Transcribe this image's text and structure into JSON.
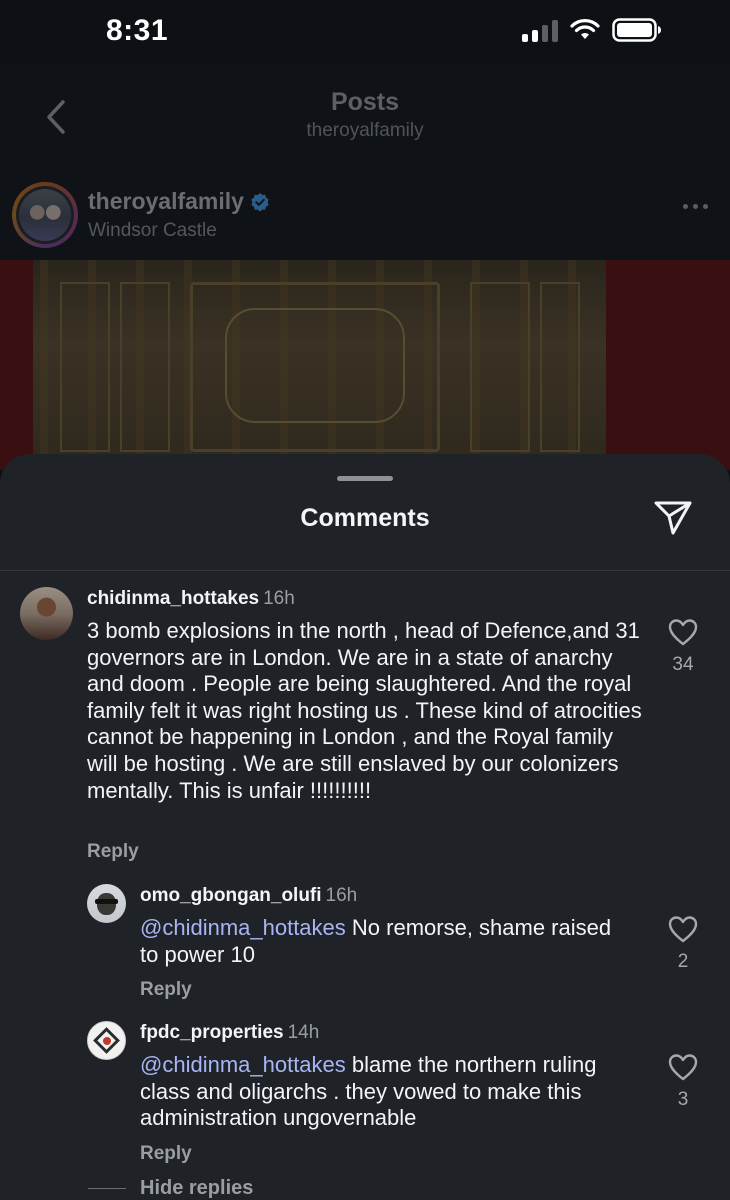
{
  "status_bar": {
    "time": "8:31"
  },
  "header": {
    "title": "Posts",
    "subtitle": "theroyalfamily"
  },
  "post": {
    "username": "theroyalfamily",
    "location": "Windsor Castle"
  },
  "comments_sheet": {
    "title": "Comments",
    "comments": [
      {
        "username": "chidinma_hottakes",
        "time": "16h",
        "text": "3 bomb explosions in the north , head of Defence,and 31 governors are in London. We are in a state of anarchy and doom . People are being slaughtered. And the royal family felt it was right hosting us . These kind of atrocities cannot be happening in London , and the Royal family will be hosting . We are still enslaved by our colonizers mentally. This is unfair !!!!!!!!!!",
        "reply_label": "Reply",
        "likes": "34"
      },
      {
        "username": "omo_gbongan_olufi",
        "time": "16h",
        "mention": "@chidinma_hottakes",
        "text": " No remorse, shame raised to power 10",
        "reply_label": "Reply",
        "likes": "2"
      },
      {
        "username": "fpdc_properties",
        "time": "14h",
        "mention": "@chidinma_hottakes",
        "text": " blame the northern ruling class and oligarchs . they vowed to make this administration ungovernable",
        "reply_label": "Reply",
        "likes": "3"
      }
    ],
    "hide_replies_label": "Hide replies"
  }
}
